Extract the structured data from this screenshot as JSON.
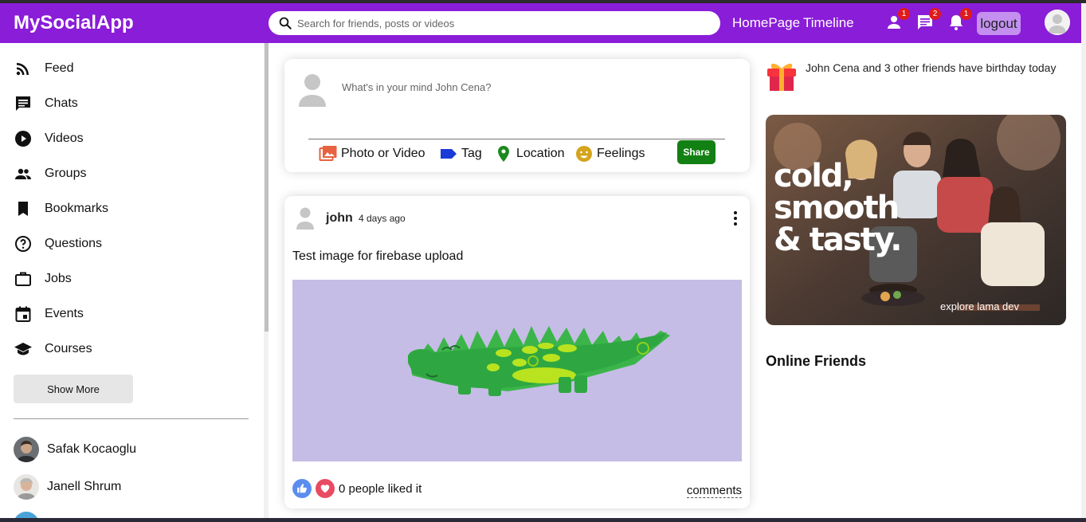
{
  "topbar": {
    "logo": "MySocialApp",
    "search_placeholder": "Search for friends, posts or videos",
    "links": [
      "HomePage",
      "Timeline"
    ],
    "badges": {
      "friends": "1",
      "chat": "2",
      "notifications": "1"
    },
    "logout": "logout"
  },
  "sidebar": {
    "items": [
      {
        "label": "Feed",
        "icon": "rss-feed-icon"
      },
      {
        "label": "Chats",
        "icon": "chat-icon"
      },
      {
        "label": "Videos",
        "icon": "play-circle-icon"
      },
      {
        "label": "Groups",
        "icon": "group-icon"
      },
      {
        "label": "Bookmarks",
        "icon": "bookmark-icon"
      },
      {
        "label": "Questions",
        "icon": "help-outline-icon"
      },
      {
        "label": "Jobs",
        "icon": "work-outline-icon"
      },
      {
        "label": "Events",
        "icon": "event-icon"
      },
      {
        "label": "Courses",
        "icon": "school-icon"
      }
    ],
    "show_more": "Show More",
    "friends": [
      "Safak Kocaoglu",
      "Janell Shrum"
    ]
  },
  "share": {
    "placeholder": "What's in your mind John Cena?",
    "options": [
      "Photo or Video",
      "Tag",
      "Location",
      "Feelings"
    ],
    "button": "Share"
  },
  "post": {
    "username": "john",
    "date": "4 days ago",
    "text": "Test image for firebase upload",
    "likes": "0 people liked it",
    "comments": "comments"
  },
  "rightbar": {
    "birthday_name": "John Cena",
    "birthday_and": " and ",
    "birthday_friends": "3 other friends",
    "birthday_rest": " have birthday today",
    "ad_line1": "cold,",
    "ad_line2": "smooth",
    "ad_line3": "& tasty.",
    "ad_footer": "explore lama dev",
    "online_title": "Online Friends"
  },
  "colors": {
    "topbar": "#8a1dd8",
    "share_button": "#138013",
    "photo_icon": "#e8623f",
    "tag_icon": "#1a3bd6",
    "location_icon": "#1d8a1d",
    "feelings_icon": "#d4a41c",
    "like": "#5b8def",
    "heart": "#e94b62"
  }
}
